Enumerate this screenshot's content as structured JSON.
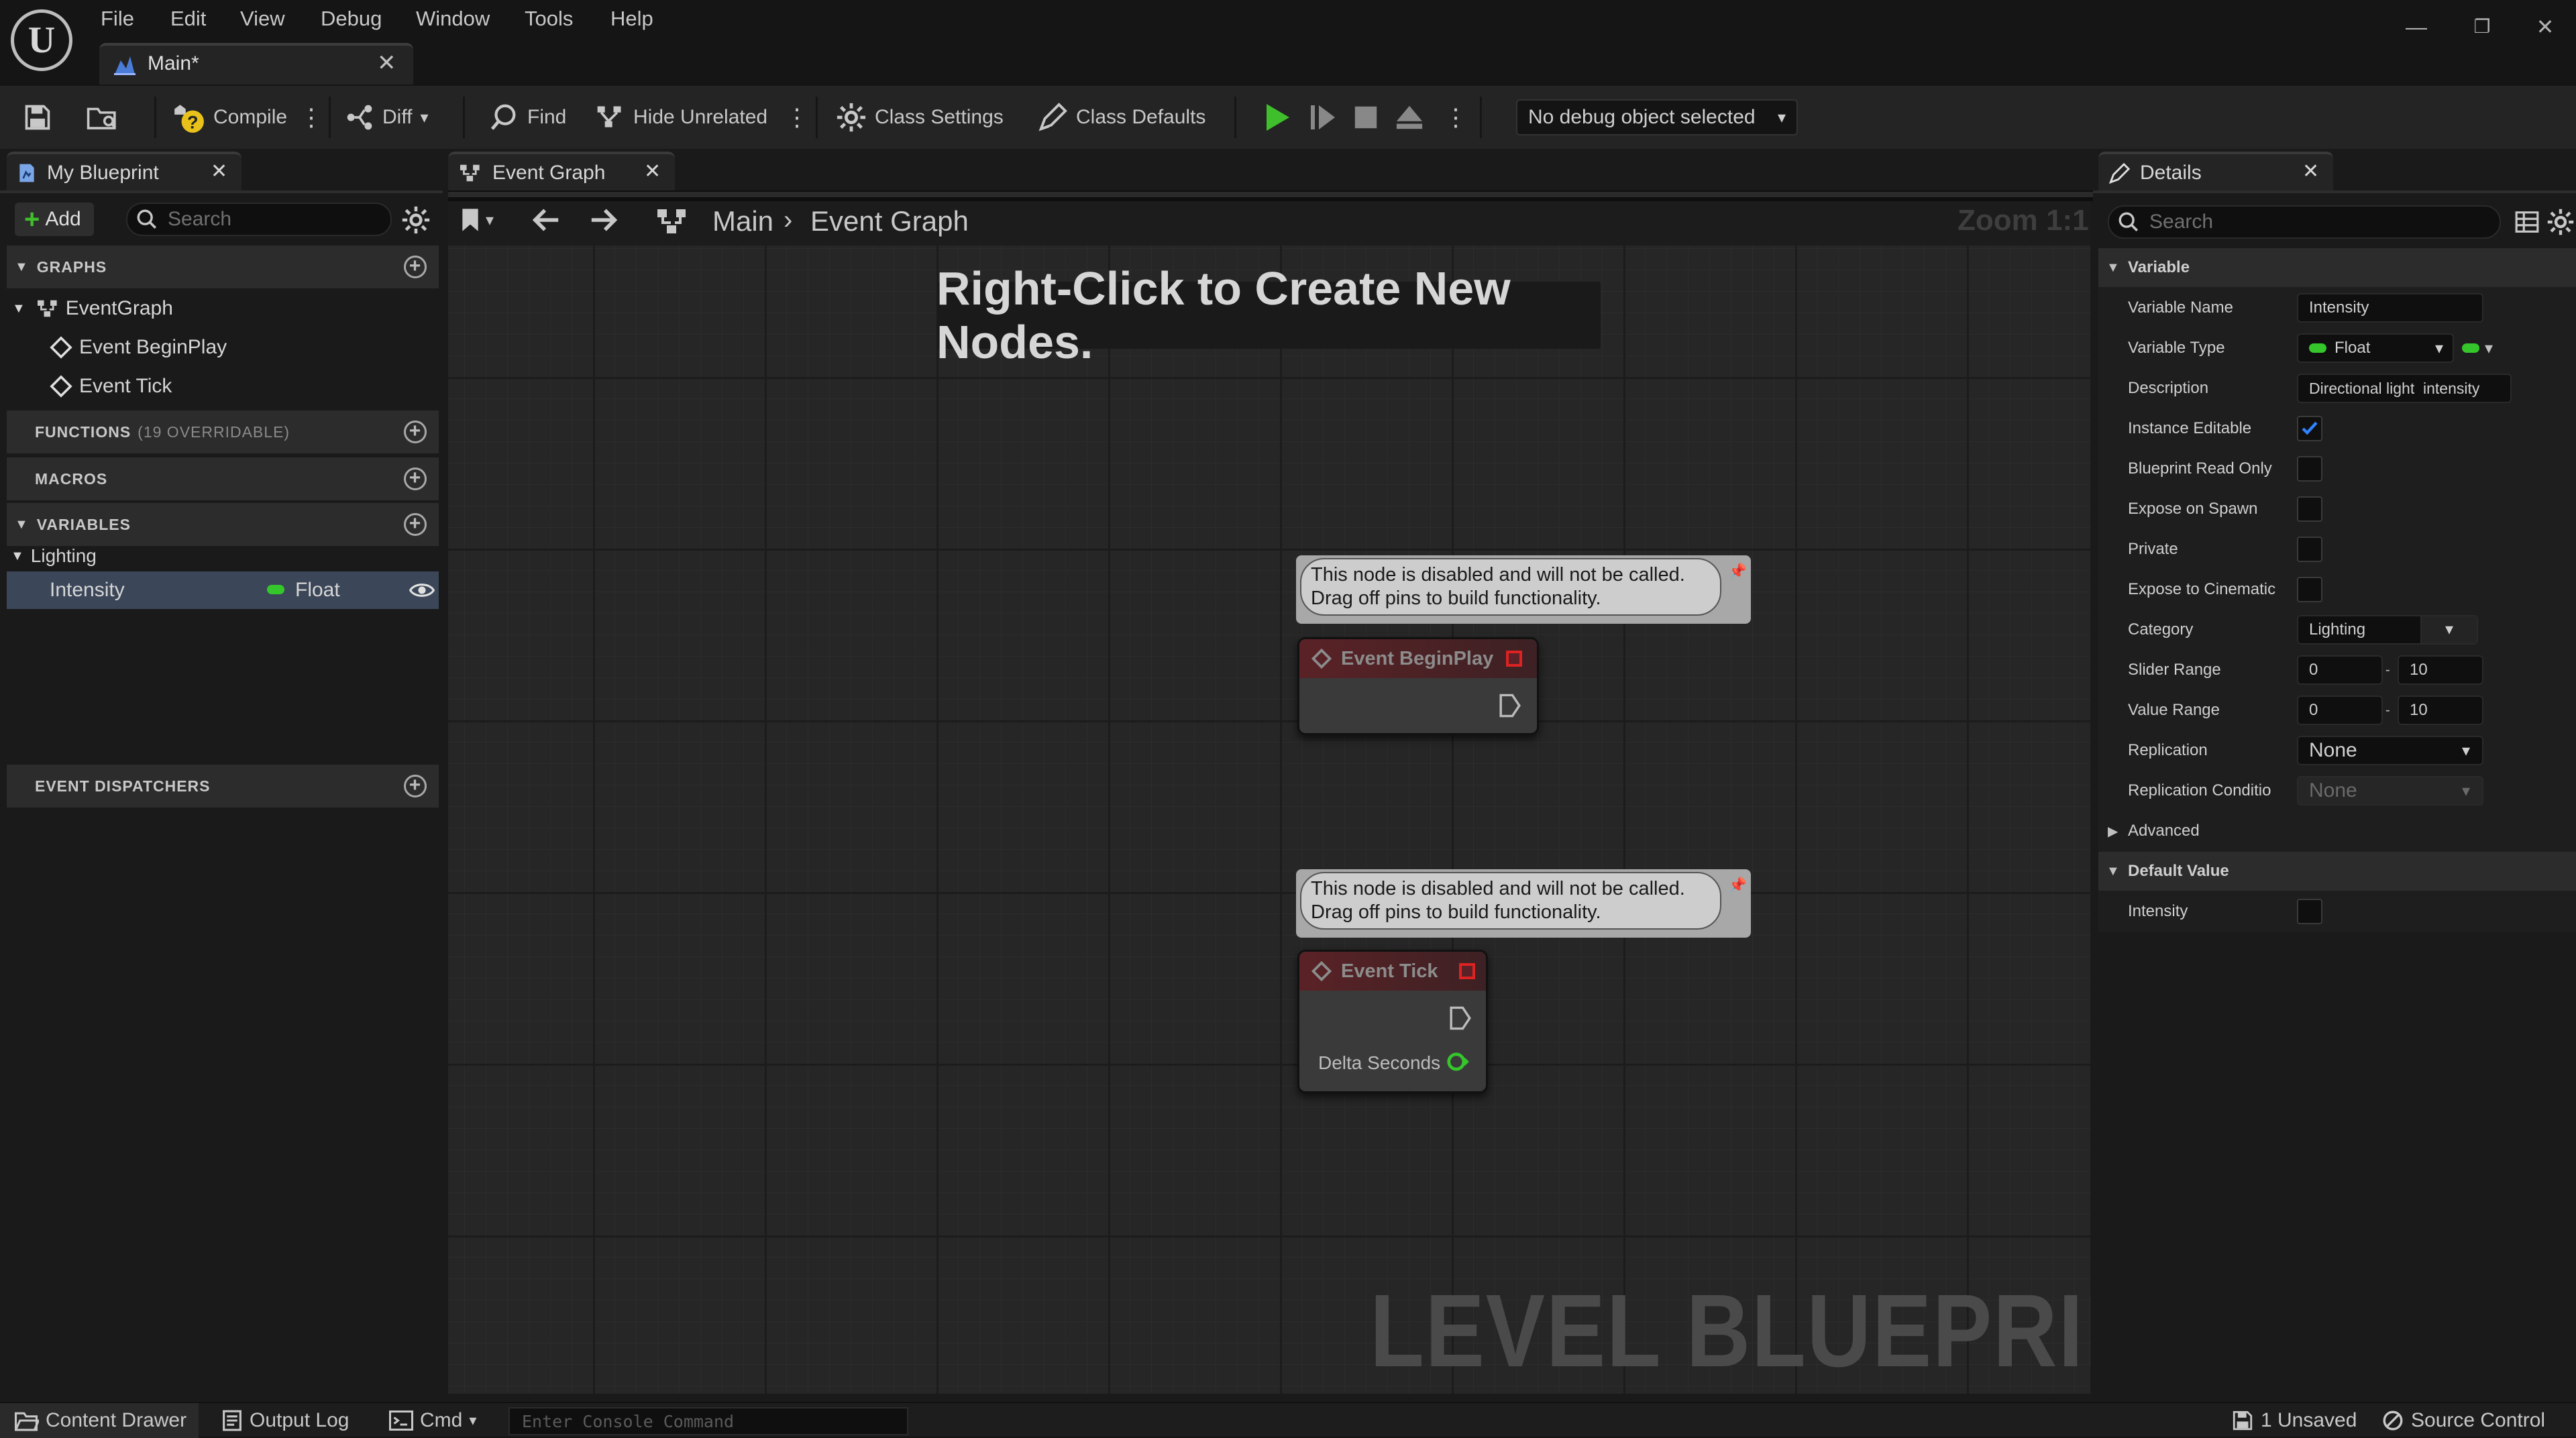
{
  "menu": [
    "File",
    "Edit",
    "View",
    "Debug",
    "Window",
    "Tools",
    "Help"
  ],
  "document_tab": {
    "title": "Main*"
  },
  "toolbar": {
    "compile": "Compile",
    "diff": "Diff",
    "find": "Find",
    "hide_unrelated": "Hide Unrelated",
    "class_settings": "Class Settings",
    "class_defaults": "Class Defaults",
    "debug_object": "No debug object selected"
  },
  "my_blueprint": {
    "tab_title": "My Blueprint",
    "add_label": "Add",
    "search_placeholder": "Search",
    "graphs_label": "GRAPHS",
    "graph_items": [
      "EventGraph",
      "Event BeginPlay",
      "Event Tick"
    ],
    "functions_label": "FUNCTIONS",
    "functions_note": "(19 OVERRIDABLE)",
    "macros_label": "MACROS",
    "variables_label": "VARIABLES",
    "var_category": "Lighting",
    "variable": {
      "name": "Intensity",
      "type": "Float"
    },
    "dispatchers_label": "EVENT DISPATCHERS"
  },
  "graph": {
    "tab_title": "Event Graph",
    "breadcrumb": [
      "Main",
      "Event Graph"
    ],
    "zoom": "Zoom 1:1",
    "hint": "Right-Click to Create New Nodes.",
    "watermark": "LEVEL BLUEPRINT",
    "disabled_line1": "This node is disabled and will not be called.",
    "disabled_line2": "Drag off pins to build functionality.",
    "node_beginplay": "Event BeginPlay",
    "node_tick": "Event Tick",
    "tick_pin": "Delta Seconds"
  },
  "details": {
    "tab_title": "Details",
    "search_placeholder": "Search",
    "variable_section": "Variable",
    "rows": {
      "variable_name": {
        "label": "Variable Name",
        "value": "Intensity"
      },
      "variable_type": {
        "label": "Variable Type",
        "value": "Float"
      },
      "description": {
        "label": "Description",
        "value": "Directional light  intensity"
      },
      "instance_editable": {
        "label": "Instance Editable",
        "checked": true
      },
      "blueprint_read_only": {
        "label": "Blueprint Read Only",
        "checked": false
      },
      "expose_on_spawn": {
        "label": "Expose on Spawn",
        "checked": false
      },
      "private": {
        "label": "Private",
        "checked": false
      },
      "expose_to_cinematics": {
        "label": "Expose to Cinematic",
        "checked": false
      },
      "category": {
        "label": "Category",
        "value": "Lighting"
      },
      "slider_range": {
        "label": "Slider Range",
        "min": "0",
        "max": "10"
      },
      "value_range": {
        "label": "Value Range",
        "min": "0",
        "max": "10"
      },
      "replication": {
        "label": "Replication",
        "value": "None"
      },
      "replication_condition": {
        "label": "Replication Conditio",
        "value": "None"
      }
    },
    "advanced": "Advanced",
    "default_value_section": "Default Value",
    "default_intensity": {
      "label": "Intensity",
      "checked": false
    }
  },
  "bottom": {
    "content_drawer": "Content Drawer",
    "output_log": "Output Log",
    "cmd": "Cmd",
    "console_placeholder": "Enter Console Command",
    "unsaved": "1 Unsaved",
    "source_control": "Source Control"
  },
  "colors": {
    "float_pin": "#35c62c",
    "play": "#3fbf2b",
    "check": "#2f83ff",
    "node_head": "#5a2226"
  }
}
